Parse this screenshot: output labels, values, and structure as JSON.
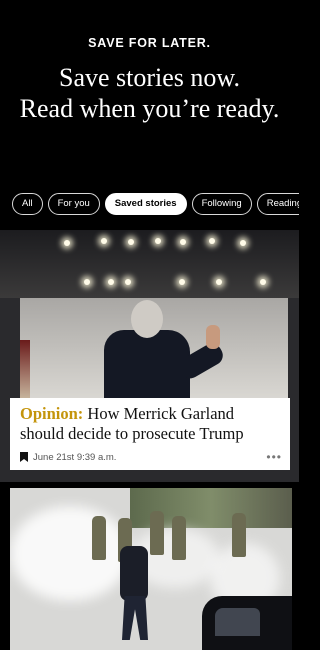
{
  "hero": {
    "eyebrow": "SAVE FOR LATER.",
    "headline_line1": "Save stories now.",
    "headline_line2": "Read when you’re ready."
  },
  "tabs": [
    {
      "label": "All",
      "active": false
    },
    {
      "label": "For you",
      "active": false
    },
    {
      "label": "Saved stories",
      "active": true
    },
    {
      "label": "Following",
      "active": false
    },
    {
      "label": "Reading His",
      "active": false
    }
  ],
  "story1": {
    "kicker": "Opinion:",
    "title": " How Merrick Garland should decide to prosecute Trump",
    "saved_time": "June 21st 9:39 a.m.",
    "more_icon": "more-horizontal-icon"
  },
  "colors": {
    "background": "#000000",
    "opinion_accent": "#c4950c",
    "active_tab_bg": "#ffffff"
  }
}
